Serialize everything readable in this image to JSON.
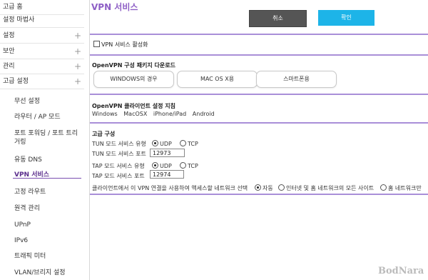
{
  "sidebar": {
    "items": [
      {
        "label": "고급 홈",
        "plus": ""
      },
      {
        "label": "설정 마법사",
        "plus": ""
      },
      {
        "label": "설정",
        "plus": "+"
      },
      {
        "label": "보안",
        "plus": "+"
      },
      {
        "label": "관리",
        "plus": "+"
      },
      {
        "label": "고급 설정",
        "plus": "+"
      }
    ],
    "sub_items": [
      {
        "label": "무선 설정"
      },
      {
        "label": "라우터 / AP 모드"
      },
      {
        "label": "포트 포워딩 / 포트 트리거링"
      },
      {
        "label": "유동 DNS"
      },
      {
        "label": "VPN 서비스"
      },
      {
        "label": "고정 라우트"
      },
      {
        "label": "원격 관리"
      },
      {
        "label": "UPnP"
      },
      {
        "label": "IPv6"
      },
      {
        "label": "트래픽 미터"
      },
      {
        "label": "VLAN/브리지 설정"
      }
    ]
  },
  "main": {
    "title": "VPN 서비스",
    "cancel_label": "취소",
    "ok_label": "확인",
    "enable_label": "VPN 서비스 활성화",
    "download_title": "OpenVPN 구성 패키지 다운로드",
    "download_buttons": [
      {
        "label": "WINDOWS의 경우"
      },
      {
        "label": "MAC OS X용"
      },
      {
        "label": "스마트폰용"
      }
    ],
    "client_title": "OpenVPN 클라이언트 설정 지침",
    "platforms": [
      "Windows",
      "MacOSX",
      "iPhone/iPad",
      "Android"
    ],
    "advanced_title": "고급 구성",
    "tun_type_label": "TUN 모드 서비스 유형",
    "tun_port_label": "TUN 모드 서비스 포트",
    "tun_port_value": "12973",
    "tap_type_label": "TAP 모드 서비스 유형",
    "tap_port_label": "TAP 모드 서비스 포트",
    "tap_port_value": "12974",
    "udp_label": "UDP",
    "tcp_label": "TCP",
    "client_access_label": "클라이언트에서 이 VPN 연결을 사용하여 액세스할 네트워크 선택",
    "access_options": [
      "자동",
      "인터넷 및 홈 네트워크의 모든 사이트",
      "홈 네트워크만"
    ],
    "watermark": "BodNara"
  },
  "colors": {
    "accent": "#8e5fc6",
    "ok_button": "#1db4e8",
    "cancel_button": "#555555",
    "separator": "#a98fd8"
  }
}
